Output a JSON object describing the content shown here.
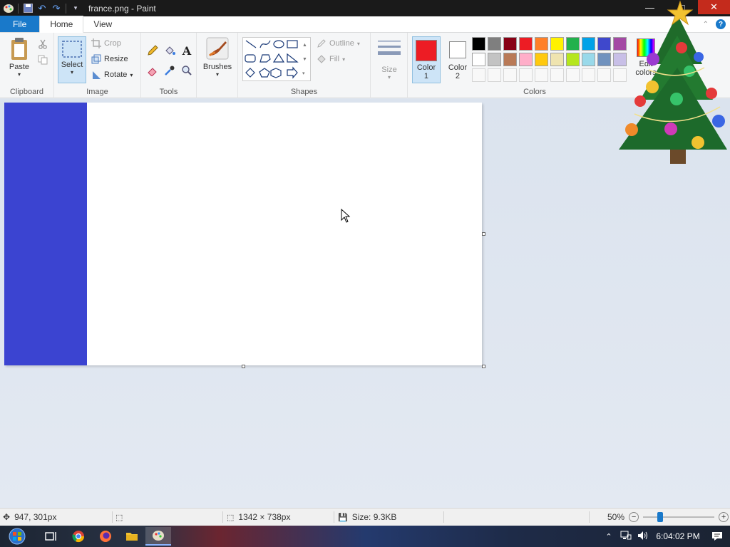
{
  "window": {
    "title": "france.png - Paint"
  },
  "tabs": {
    "file": "File",
    "home": "Home",
    "view": "View"
  },
  "ribbon": {
    "clipboard": {
      "label": "Clipboard",
      "paste": "Paste"
    },
    "image": {
      "label": "Image",
      "select": "Select",
      "crop": "Crop",
      "resize": "Resize",
      "rotate": "Rotate"
    },
    "tools": {
      "label": "Tools"
    },
    "brushes": {
      "label": "Brushes"
    },
    "shapes": {
      "label": "Shapes",
      "outline": "Outline",
      "fill": "Fill"
    },
    "size": {
      "label": "Size"
    },
    "colors": {
      "label": "Colors",
      "color1_label": "Color 1",
      "color2_label": "Color 2",
      "color1_value": "#ed1c24",
      "color2_value": "#ffffff",
      "edit_label": "Edit colors",
      "palette_row1": [
        "#000000",
        "#7f7f7f",
        "#880015",
        "#ed1c24",
        "#ff7f27",
        "#fff200",
        "#22b14c",
        "#00a2e8",
        "#3f48cc",
        "#a349a4"
      ],
      "palette_row2": [
        "#ffffff",
        "#c3c3c3",
        "#b97a57",
        "#ffaec9",
        "#ffc90e",
        "#efe4b0",
        "#b5e61d",
        "#99d9ea",
        "#7092be",
        "#c8bfe7"
      ]
    }
  },
  "canvas": {
    "blue_band_color": "#3b44d1"
  },
  "status": {
    "cursor_pos": "947, 301px",
    "dimensions": "1342 × 738px",
    "size": "Size: 9.3KB",
    "zoom": "50%"
  },
  "taskbar": {
    "clock": "6:04:02 PM"
  }
}
